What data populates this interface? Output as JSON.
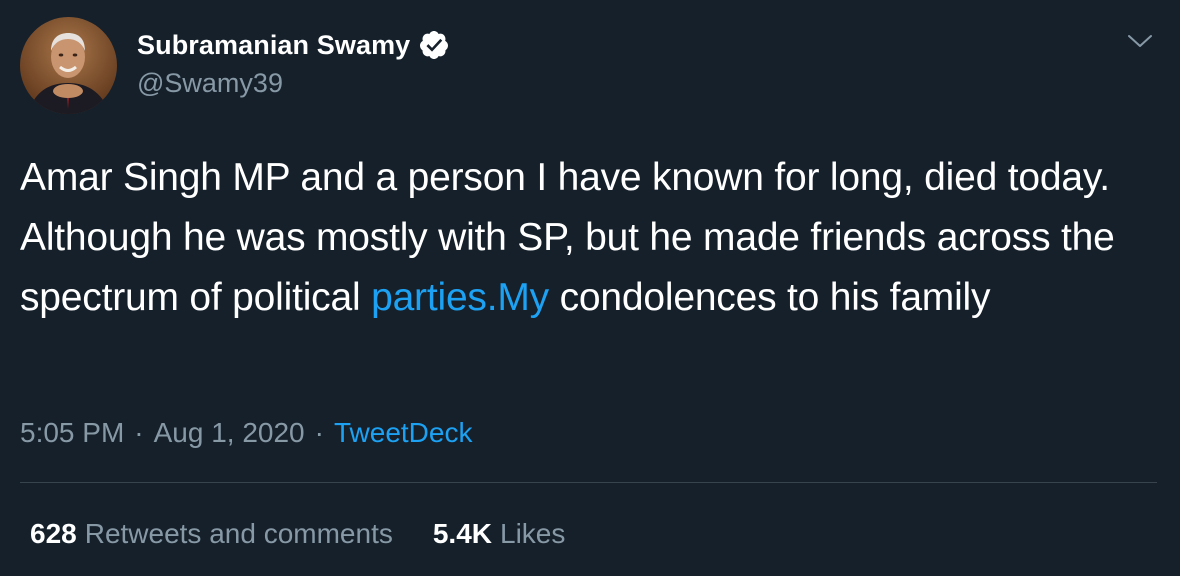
{
  "author": {
    "display_name": "Subramanian Swamy",
    "handle": "@Swamy39",
    "verified": true,
    "avatar_icon": "profile-photo"
  },
  "tweet": {
    "text_part1": "Amar Singh MP and a person I have known for long, died today. Although he was mostly with SP, but he made friends across the spectrum of political ",
    "link_text": "parties.My",
    "text_part2": " condolences to his family"
  },
  "meta": {
    "time": "5:05 PM",
    "separator": "·",
    "date": "Aug 1, 2020",
    "source": "TweetDeck"
  },
  "stats": {
    "retweets_count": "628",
    "retweets_label": "Retweets and comments",
    "likes_count": "5.4K",
    "likes_label": "Likes"
  },
  "colors": {
    "background": "#15202b",
    "text": "#ffffff",
    "secondary": "#8899a6",
    "link": "#1da1f2",
    "divider": "#38444d"
  },
  "icons": {
    "verified": "verified-badge-icon",
    "caret": "chevron-down-icon"
  }
}
